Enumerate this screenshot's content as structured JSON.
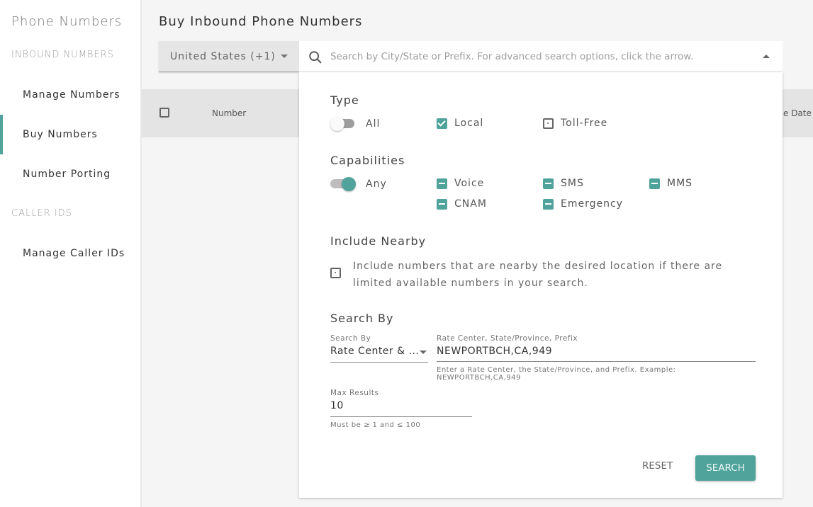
{
  "sidebar": {
    "title": "Phone Numbers",
    "sections": [
      {
        "label": "INBOUND NUMBERS"
      },
      {
        "label": "CALLER IDS"
      }
    ],
    "items": [
      {
        "label": "Manage Numbers",
        "active": false
      },
      {
        "label": "Buy Numbers",
        "active": true
      },
      {
        "label": "Number Porting",
        "active": false
      },
      {
        "label": "Manage Caller IDs",
        "active": false
      }
    ]
  },
  "header": {
    "title": "Buy Inbound Phone Numbers",
    "country_select": "United States (+1)",
    "search_placeholder": "Search by City/State or Prefix. For advanced search options, click the arrow."
  },
  "table": {
    "columns": [
      "Number",
      "e Date"
    ]
  },
  "panel": {
    "type": {
      "title": "Type",
      "toggle_all": {
        "label": "All",
        "on": false
      },
      "options": [
        {
          "label": "Local",
          "state": "checked"
        },
        {
          "label": "Toll-Free",
          "state": "unchecked"
        }
      ]
    },
    "capabilities": {
      "title": "Capabilities",
      "toggle_any": {
        "label": "Any",
        "on": true
      },
      "options": [
        {
          "label": "Voice",
          "state": "indeterminate"
        },
        {
          "label": "SMS",
          "state": "indeterminate"
        },
        {
          "label": "MMS",
          "state": "indeterminate"
        },
        {
          "label": "CNAM",
          "state": "indeterminate"
        },
        {
          "label": "Emergency",
          "state": "indeterminate"
        }
      ]
    },
    "nearby": {
      "title": "Include Nearby",
      "checked": false,
      "text": "Include numbers that are nearby the desired location if there are limited available numbers in your search."
    },
    "search_by": {
      "title": "Search By",
      "select_label": "Search By",
      "select_value": "Rate Center & ...",
      "input_label": "Rate Center, State/Province, Prefix",
      "input_value": "NEWPORTBCH,CA,949",
      "input_hint_line1": "Enter a Rate Center, the State/Province, and Prefix. Example:",
      "input_hint_line2": "NEWPORTBCH,CA,949",
      "max_label": "Max Results",
      "max_value": "10",
      "max_hint": "Must be ≥ 1 and ≤ 100"
    },
    "buttons": {
      "reset": "RESET",
      "search": "SEARCH"
    }
  },
  "colors": {
    "accent": "#4fa39b"
  }
}
